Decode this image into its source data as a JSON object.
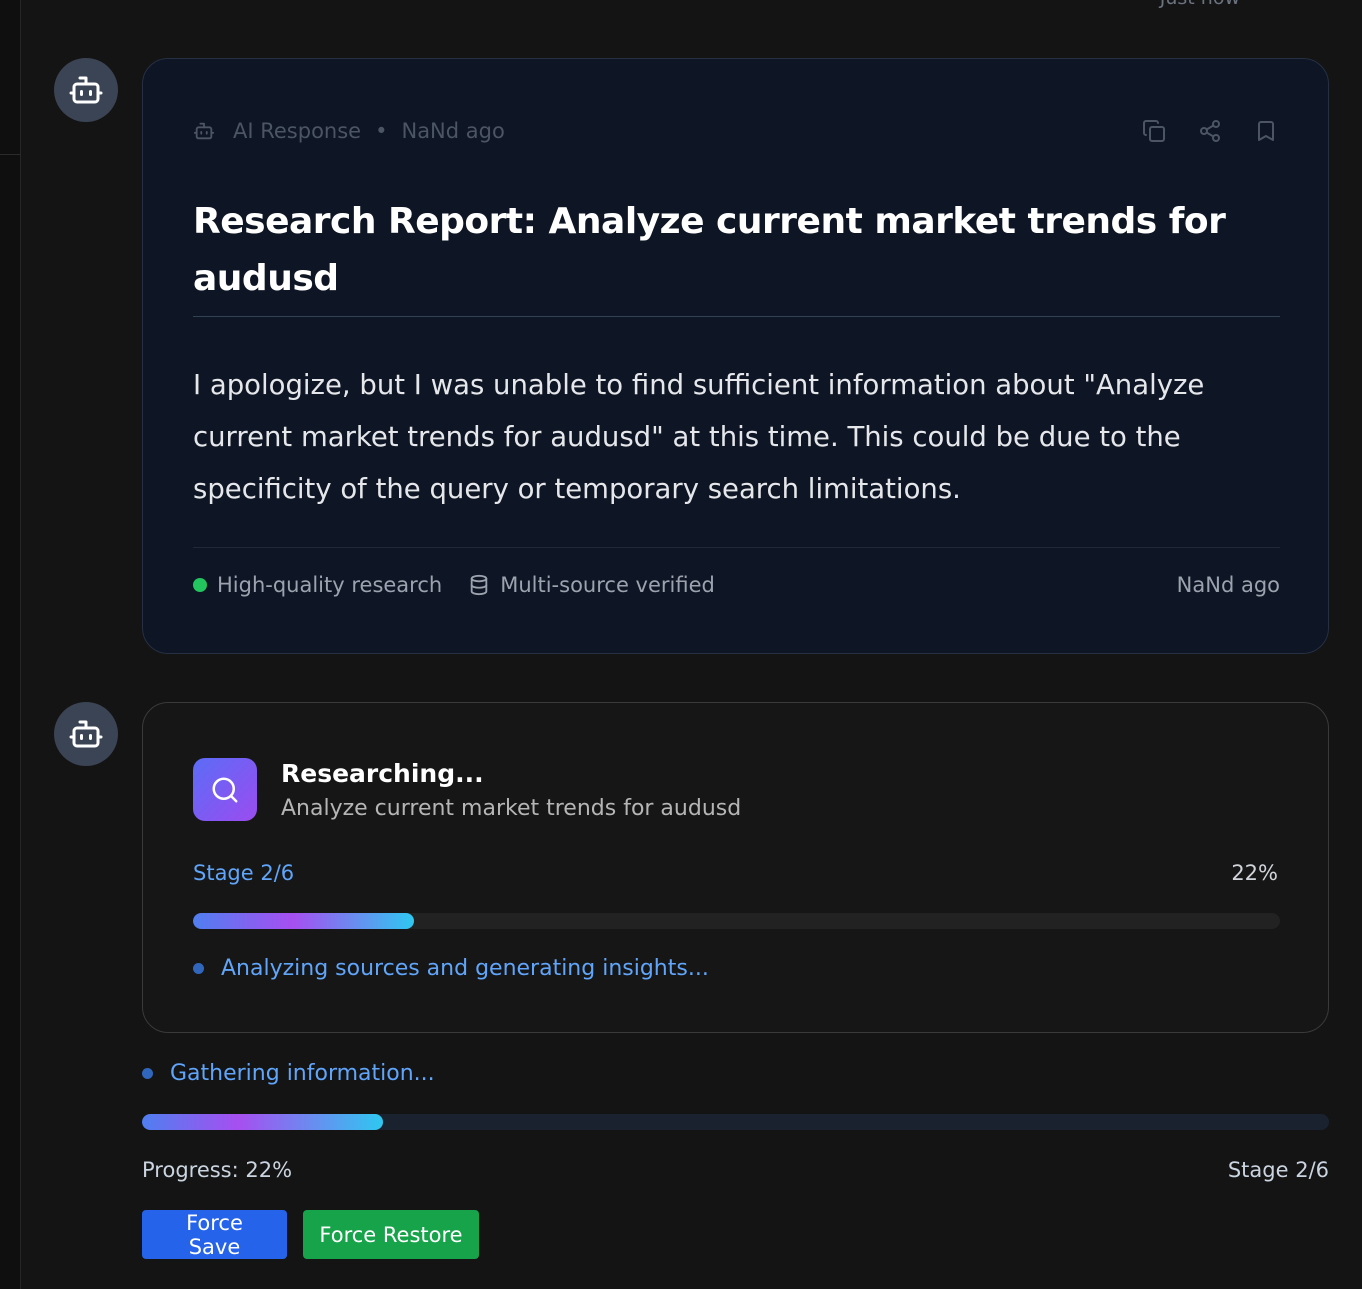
{
  "top_timestamp": "Just now",
  "response_card": {
    "meta_label": "AI Response",
    "meta_separator": "•",
    "meta_time": "NaNd ago",
    "title": "Research Report: Analyze current market trends for audusd",
    "body": "I apologize, but I was unable to find sufficient information about \"Analyze current market trends for audusd\" at this time. This could be due to the specificity of the query or temporary search limitations.",
    "quality_label": "High-quality research",
    "verified_label": "Multi-source verified",
    "footer_time": "NaNd ago",
    "icons": [
      "bot-icon",
      "copy-icon",
      "share-icon",
      "bookmark-icon",
      "database-icon"
    ]
  },
  "research_card": {
    "title": "Researching...",
    "subtitle": "Analyze current market trends for audusd",
    "stage_label": "Stage 2/6",
    "percent_label": "22%",
    "progress": 0.22,
    "step_text": "Analyzing sources and generating insights..."
  },
  "status": {
    "gather_text": "Gathering information...",
    "progress": 0.22,
    "progress_label": "Progress: 22%",
    "stage_label": "Stage 2/6"
  },
  "buttons": {
    "force_save": "Force Save",
    "force_restore": "Force Restore"
  },
  "colors": {
    "accent_blue": "#60a5fa",
    "save_button": "#2563eb",
    "restore_button": "#16a34a",
    "quality_dot": "#22c55e"
  }
}
